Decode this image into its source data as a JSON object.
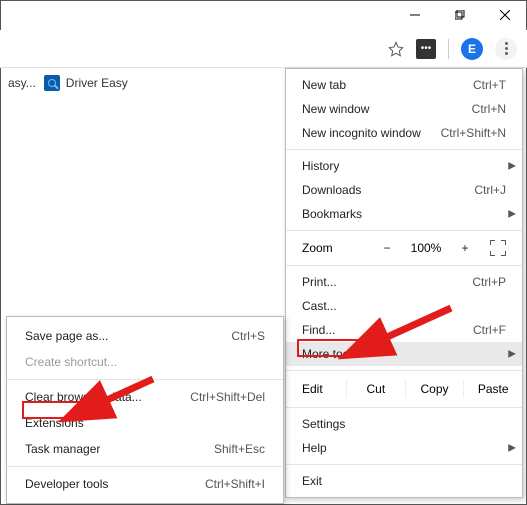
{
  "titlebar": {
    "min": "–",
    "max": "❐",
    "close": "✕"
  },
  "toolbar": {
    "avatar_letter": "E"
  },
  "bookmarks": {
    "item1_partial": "asy...",
    "item2_label": "Driver Easy"
  },
  "menu": {
    "new_tab": "New tab",
    "new_tab_sc": "Ctrl+T",
    "new_window": "New window",
    "new_window_sc": "Ctrl+N",
    "incognito": "New incognito window",
    "incognito_sc": "Ctrl+Shift+N",
    "history": "History",
    "downloads": "Downloads",
    "downloads_sc": "Ctrl+J",
    "bookmarks": "Bookmarks",
    "zoom": "Zoom",
    "zoom_val": "100%",
    "zoom_minus": "−",
    "zoom_plus": "+",
    "print": "Print...",
    "print_sc": "Ctrl+P",
    "cast": "Cast...",
    "find": "Find...",
    "find_sc": "Ctrl+F",
    "more_tools": "More tools",
    "edit": "Edit",
    "cut": "Cut",
    "copy": "Copy",
    "paste": "Paste",
    "settings": "Settings",
    "help": "Help",
    "exit": "Exit"
  },
  "submenu": {
    "save_page": "Save page as...",
    "save_page_sc": "Ctrl+S",
    "create_shortcut": "Create shortcut...",
    "clear_data": "Clear browsing data...",
    "clear_data_sc": "Ctrl+Shift+Del",
    "extensions": "Extensions",
    "task_manager": "Task manager",
    "task_manager_sc": "Shift+Esc",
    "dev_tools": "Developer tools",
    "dev_tools_sc": "Ctrl+Shift+I"
  }
}
